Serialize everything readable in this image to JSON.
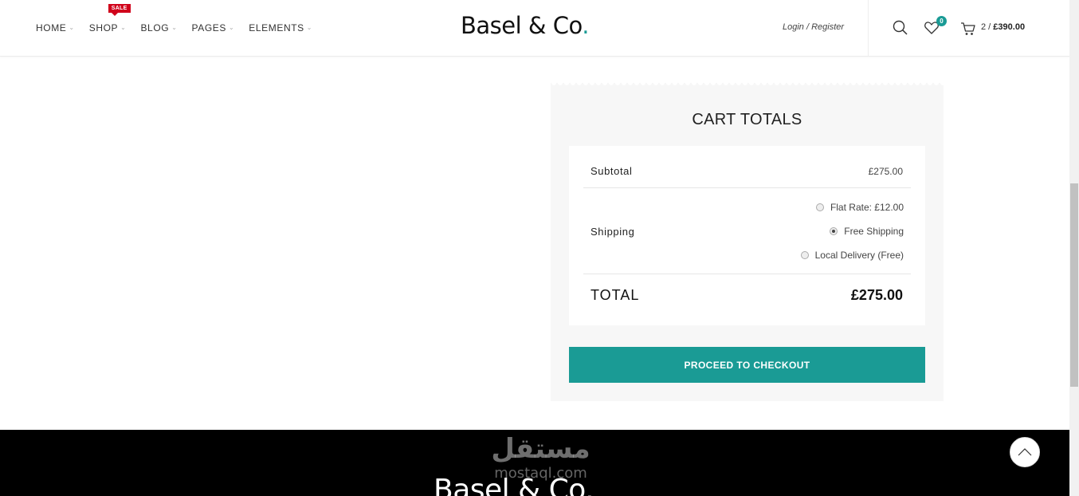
{
  "header": {
    "nav": [
      {
        "label": "HOME"
      },
      {
        "label": "SHOP",
        "badge": "SALE"
      },
      {
        "label": "BLOG"
      },
      {
        "label": "PAGES"
      },
      {
        "label": "ELEMENTS"
      }
    ],
    "logo_text": "Basel & Co",
    "logo_dot": ".",
    "login_label": "Login / Register",
    "wishlist_count": "0",
    "cart_count": "2 /",
    "cart_total": "£390.00"
  },
  "cart_totals": {
    "title": "CART TOTALS",
    "subtotal_label": "Subtotal",
    "subtotal_value": "£275.00",
    "shipping_label": "Shipping",
    "shipping_options": [
      {
        "label": "Flat Rate: £12.00",
        "selected": false
      },
      {
        "label": "Free Shipping",
        "selected": true
      },
      {
        "label": "Local Delivery (Free)",
        "selected": false
      }
    ],
    "total_label": "TOTAL",
    "total_value": "£275.00",
    "checkout_label": "PROCEED TO CHECKOUT"
  },
  "footer": {
    "logo_text": "Basel & Co.",
    "watermark_ar": "مستقل",
    "watermark_en": "mostaql.com"
  },
  "colors": {
    "accent": "#1a9b95",
    "sale_badge": "#d0021b",
    "footer_bg": "#000000"
  }
}
